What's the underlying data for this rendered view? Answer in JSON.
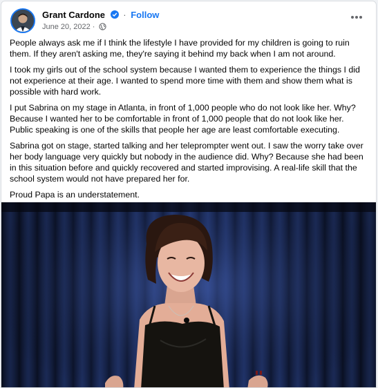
{
  "post": {
    "author": "Grant Cardone",
    "follow_label": "Follow",
    "separator": "·",
    "date": "June 20, 2022",
    "meta_separator": "·",
    "more_icon": "more-horizontal-icon",
    "verified_icon": "verified-badge-icon",
    "audience_icon": "globe-icon",
    "paragraphs": [
      "People always ask me if I think the lifestyle I have provided for my children is going to ruin them. If they aren't asking me, they're saying it behind my back when I am not around.",
      "I took my girls out of the school system because I wanted them to experience the things I did not experience at their age. I wanted to spend more time with them and show them what is possible with hard work.",
      "I put Sabrina on my stage in Atlanta, in front of 1,000 people who do not look like her. Why? Because I wanted her to be comfortable in front of 1,000 people that do not look like her. Public speaking is one of the skills that people her age are least comfortable executing.",
      "Sabrina got on stage, started talking and her teleprompter went out. I saw the worry take over her body language very quickly but nobody in the audience did. Why? Because she had been in this situation before and quickly recovered and started improvising. A real-life skill that the school system would not have prepared her for.",
      "Proud Papa is an understatement."
    ]
  },
  "colors": {
    "accent": "#1877f2",
    "secondary_text": "#65676b",
    "curtain": "#1a2a5c"
  }
}
